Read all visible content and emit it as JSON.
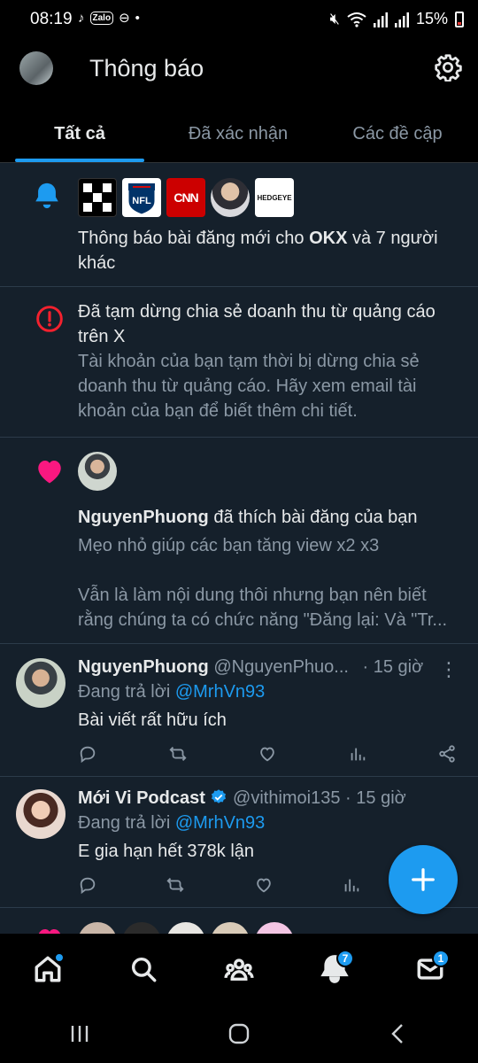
{
  "status_bar": {
    "time": "08:19",
    "zalo": "Zalo",
    "battery": "15%"
  },
  "header": {
    "title": "Thông báo"
  },
  "tabs": [
    {
      "label": "Tất cả",
      "active": true
    },
    {
      "label": "Đã xác nhận",
      "active": false
    },
    {
      "label": "Các đề cập",
      "active": false
    }
  ],
  "notifications": {
    "new_posts": {
      "logos": [
        "OKX",
        "NFL",
        "CNN",
        "person",
        "HEDGEYE"
      ],
      "nfl_label": "NFL",
      "cnn_label": "CNN",
      "hedgeye_label": "HEDGEYE",
      "text_prefix": "Thông báo bài đăng mới cho ",
      "text_bold": "OKX",
      "text_suffix": " và 7 người khác"
    },
    "revenue": {
      "title": "Đã tạm dừng chia sẻ doanh thu từ quảng cáo trên X",
      "body": "Tài khoản của bạn tạm thời bị dừng chia sẻ doanh thu từ quảng cáo. Hãy xem email tài khoản của bạn để biết thêm chi tiết."
    },
    "like": {
      "user": "NguyenPhuong",
      "action": " đã thích bài đăng của bạn",
      "snippet_line1": "Mẹo nhỏ giúp các bạn tăng view x2 x3",
      "snippet_line2": "Vẫn là làm nội dung thôi nhưng bạn nên biết rằng chúng ta có chức năng \"Đăng lại: Và \"Tr..."
    }
  },
  "replies": [
    {
      "name": "NguyenPhuong",
      "handle": "@NguyenPhuo...",
      "time": "· 15 giờ",
      "replying_label": "Đang trả lời ",
      "replying_to": "@MrhVn93",
      "text": "Bài viết rất hữu ích"
    },
    {
      "name": "Mới Vi Podcast",
      "handle": "@vithimoi135",
      "time": "· 15 giờ",
      "replying_label": "Đang trả lời ",
      "replying_to": "@MrhVn93",
      "text": "E gia hạn hết 378k lận"
    }
  ],
  "bottom_nav": {
    "notifications_badge": "7",
    "messages_badge": "1"
  },
  "colors": {
    "accent": "#1d9bf0",
    "like": "#f91880",
    "alert": "#f4212e",
    "feed_bg": "#15202b"
  }
}
